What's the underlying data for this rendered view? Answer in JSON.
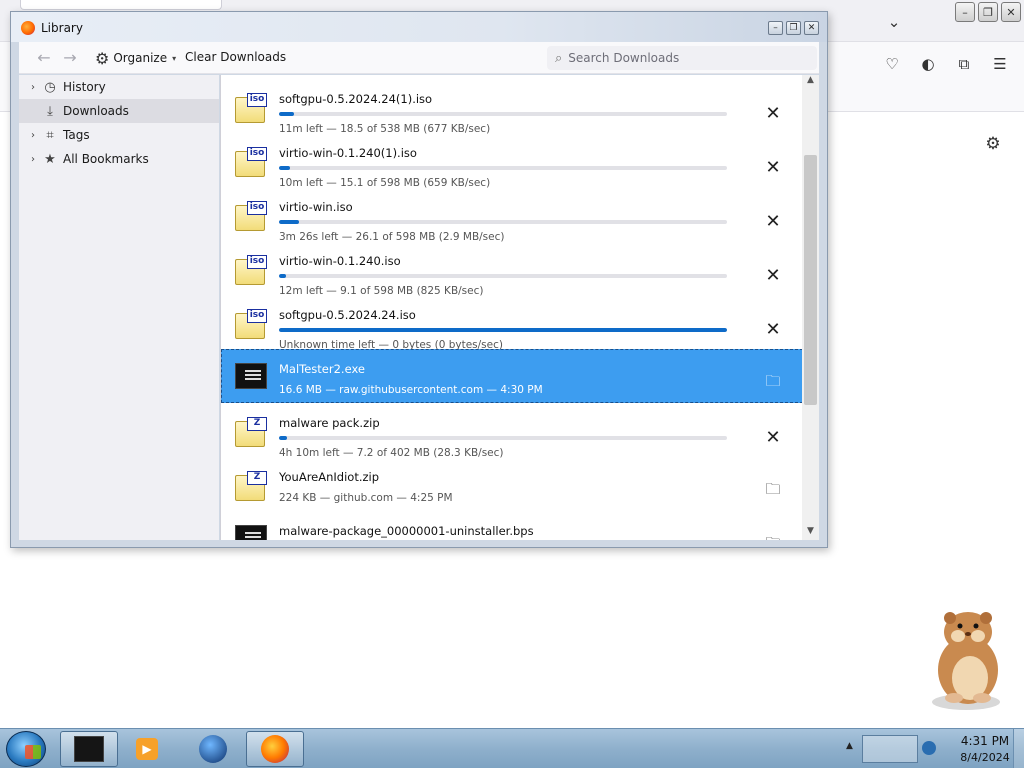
{
  "window": {
    "title": "Library",
    "minimize_glyph": "–",
    "maximize_glyph": "❐",
    "close_glyph": "✕"
  },
  "toolbar": {
    "back_glyph": "←",
    "forward_glyph": "→",
    "organize_label": "Organize",
    "organize_caret": "▾",
    "clear_downloads_label": "Clear Downloads",
    "search_placeholder": "Search Downloads"
  },
  "sidebar": {
    "items": [
      {
        "label": "History",
        "twisty": "›",
        "icon": "clock-icon",
        "selected": false
      },
      {
        "label": "Downloads",
        "twisty": "",
        "icon": "download-icon",
        "selected": true
      },
      {
        "label": "Tags",
        "twisty": "›",
        "icon": "tag-icon",
        "selected": false
      },
      {
        "label": "All Bookmarks",
        "twisty": "›",
        "icon": "star-icon",
        "selected": false
      }
    ]
  },
  "downloads": [
    {
      "name": "softgpu-0.5.2024.24(1).iso",
      "status": "11m left — 18.5 of 538 MB (677 KB/sec)",
      "progress": 0.034,
      "type": "iso",
      "action": "cancel",
      "selected": false
    },
    {
      "name": "virtio-win-0.1.240(1).iso",
      "status": "10m left — 15.1 of 598 MB (659 KB/sec)",
      "progress": 0.025,
      "type": "iso",
      "action": "cancel",
      "selected": false
    },
    {
      "name": "virtio-win.iso",
      "status": "3m 26s left — 26.1 of 598 MB (2.9 MB/sec)",
      "progress": 0.044,
      "type": "iso",
      "action": "cancel",
      "selected": false
    },
    {
      "name": "virtio-win-0.1.240.iso",
      "status": "12m left — 9.1 of 598 MB (825 KB/sec)",
      "progress": 0.015,
      "type": "iso",
      "action": "cancel",
      "selected": false
    },
    {
      "name": "softgpu-0.5.2024.24.iso",
      "status": "Unknown time left — 0 bytes (0 bytes/sec)",
      "progress": 1.0,
      "type": "iso",
      "action": "cancel",
      "selected": false
    },
    {
      "name": "MalTester2.exe",
      "status": "16.6 MB — raw.githubusercontent.com — 4:30 PM",
      "progress": null,
      "type": "exe",
      "action": "folder",
      "selected": true
    },
    {
      "name": "malware pack.zip",
      "status": "4h 10m left — 7.2 of 402 MB (28.3 KB/sec)",
      "progress": 0.018,
      "type": "zip",
      "action": "cancel",
      "selected": false
    },
    {
      "name": "YouAreAnIdiot.zip",
      "status": "224 KB — github.com — 4:25 PM",
      "progress": null,
      "type": "zip",
      "action": "folder",
      "selected": false
    },
    {
      "name": "malware-package_00000001-uninstaller.bps",
      "status": "",
      "progress": null,
      "type": "exe",
      "action": "folder",
      "selected": false
    }
  ],
  "file_tags": {
    "iso": "iso",
    "zip": "Z"
  },
  "icons": {
    "cancel": "✕",
    "folder": "🗀"
  },
  "colors": {
    "accent": "#3d9df0",
    "progress": "#0e6bc8"
  },
  "taskbar": {
    "clock_time": "4:31 PM",
    "clock_date": "8/4/2024",
    "tray_up": "▲"
  }
}
